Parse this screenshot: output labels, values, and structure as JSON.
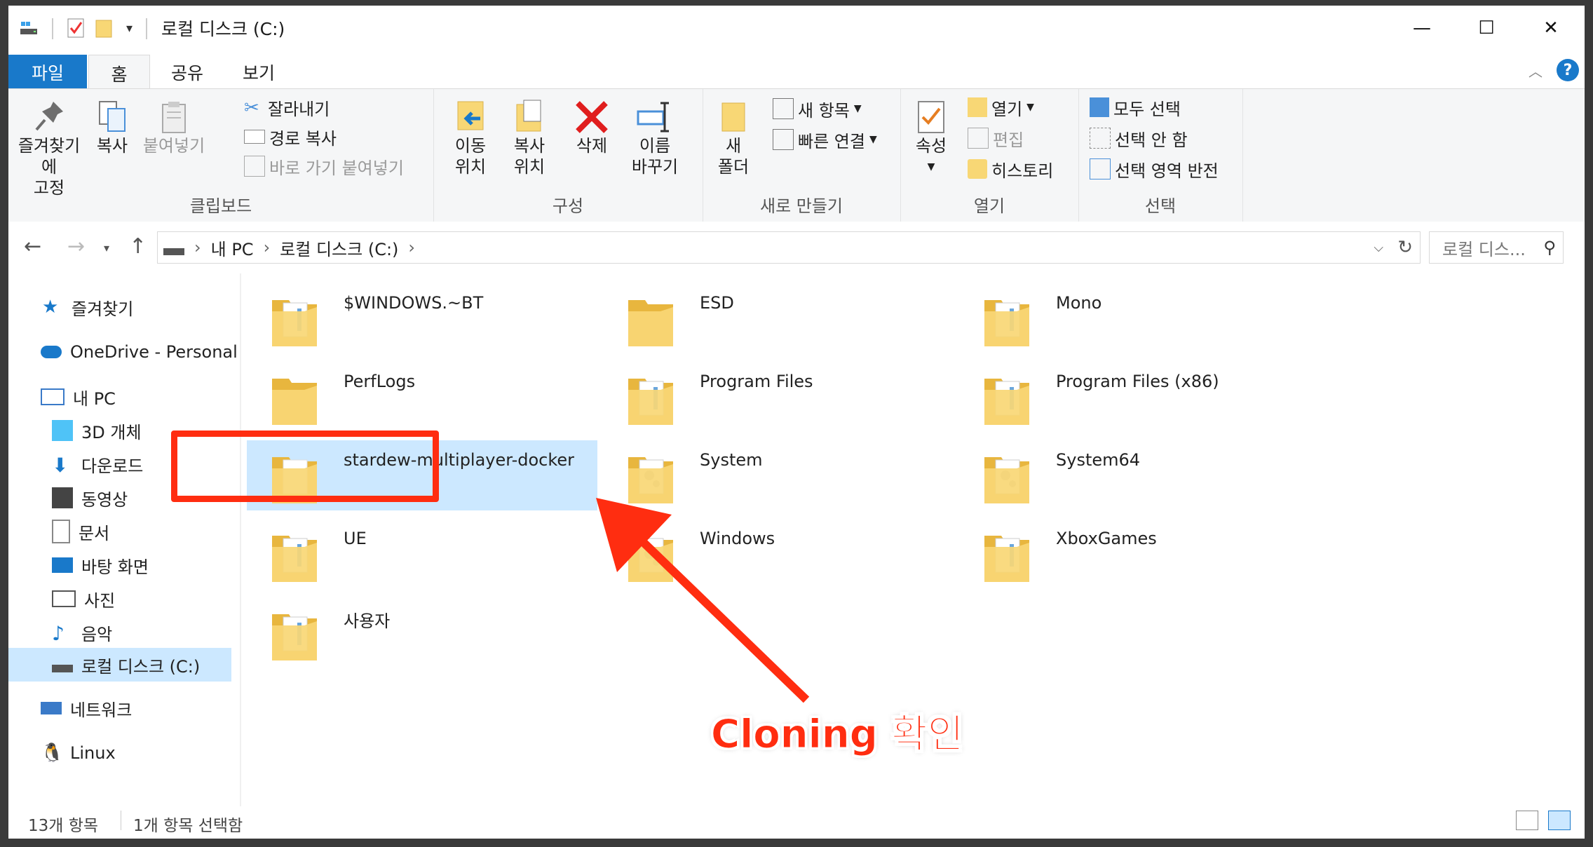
{
  "window": {
    "title": "로컬 디스크 (C:)",
    "controls": {
      "minimize": "—",
      "maximize": "☐",
      "close": "✕"
    }
  },
  "tabs": {
    "file": "파일",
    "home": "홈",
    "share": "공유",
    "view": "보기"
  },
  "ribbon": {
    "clipboard": {
      "label": "클립보드",
      "pin": "즐겨찾기에\n고정",
      "copy": "복사",
      "paste": "붙여넣기",
      "cut": "잘라내기",
      "copy_path": "경로 복사",
      "paste_shortcut": "바로 가기 붙여넣기"
    },
    "organize": {
      "label": "구성",
      "move_to": "이동\n위치",
      "copy_to": "복사\n위치",
      "delete": "삭제",
      "rename": "이름\n바꾸기"
    },
    "new": {
      "label": "새로 만들기",
      "new_folder": "새\n폴더",
      "new_item": "새 항목",
      "easy_access": "빠른 연결"
    },
    "open": {
      "label": "열기",
      "properties": "속성",
      "open": "열기",
      "edit": "편집",
      "history": "히스토리"
    },
    "select": {
      "label": "선택",
      "select_all": "모두 선택",
      "select_none": "선택 안 함",
      "invert": "선택 영역 반전"
    }
  },
  "address": {
    "crumbs": [
      "내 PC",
      "로컬 디스크 (C:)"
    ],
    "search_placeholder": "로컬 디스..."
  },
  "nav": {
    "favorites": "즐겨찾기",
    "onedrive": "OneDrive - Personal",
    "this_pc": "내 PC",
    "objects3d": "3D 개체",
    "downloads": "다운로드",
    "videos": "동영상",
    "documents": "문서",
    "desktop": "바탕 화면",
    "pictures": "사진",
    "music": "음악",
    "local_disk": "로컬 디스크 (C:)",
    "network": "네트워크",
    "linux": "Linux"
  },
  "folders": [
    {
      "name": "$WINDOWS.~BT",
      "kind": "docs"
    },
    {
      "name": "ESD",
      "kind": "plain"
    },
    {
      "name": "Mono",
      "kind": "docs"
    },
    {
      "name": "PerfLogs",
      "kind": "plain"
    },
    {
      "name": "Program Files",
      "kind": "docs"
    },
    {
      "name": "Program Files (x86)",
      "kind": "docs"
    },
    {
      "name": "stardew-multiplayer-docker",
      "kind": "white",
      "selected": true
    },
    {
      "name": "System",
      "kind": "gear"
    },
    {
      "name": "System64",
      "kind": "gear"
    },
    {
      "name": "UE",
      "kind": "docs"
    },
    {
      "name": "Windows",
      "kind": "gear"
    },
    {
      "name": "XboxGames",
      "kind": "docs"
    },
    {
      "name": "사용자",
      "kind": "docs"
    }
  ],
  "status": {
    "count": "13개 항목",
    "selected": "1개 항목 선택함"
  },
  "annotation": {
    "text": "Cloning 확인"
  },
  "colors": {
    "accent": "#1979ca",
    "selection": "#cce8ff",
    "annotation": "#ff2d10",
    "folder": "#f8d775"
  }
}
